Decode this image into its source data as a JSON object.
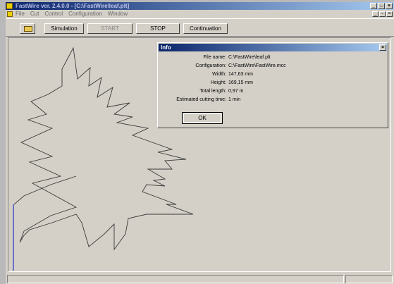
{
  "window": {
    "title": "FastWire  ver. 2.4.0.0 - [C:\\FastWire\\leaf.plt]",
    "controls": [
      "_",
      "□",
      "×"
    ],
    "mdi_controls": [
      "_",
      "▫",
      "×"
    ]
  },
  "menu": {
    "items": [
      "File",
      "Cut",
      "Control",
      "Configuration",
      "Window"
    ]
  },
  "toolbar": {
    "open_icon": "folder-open-icon",
    "simulation": "Simulation",
    "start": "START",
    "stop": "STOP",
    "continuation": "Continuation"
  },
  "dialog": {
    "title": "Info",
    "close": "×",
    "rows": [
      {
        "label": "File name:",
        "value": "C:\\FastWire\\leaf.plt"
      },
      {
        "label": "Configuration:",
        "value": "C:\\FastWire\\FastWire.mcc"
      },
      {
        "label": "Width:",
        "value": "147,63 mm"
      },
      {
        "label": "Height:",
        "value": "169,15 mm"
      },
      {
        "label": "Total length:",
        "value": "0,97 m"
      },
      {
        "label": "Estimated cutting time:",
        "value": "1 min"
      }
    ],
    "ok": "OK"
  },
  "colors": {
    "titlebar_start": "#0a246a",
    "titlebar_end": "#a6caf0",
    "face": "#d4d0c8",
    "path": "#3a3a3a",
    "axis": "#2030c0"
  }
}
